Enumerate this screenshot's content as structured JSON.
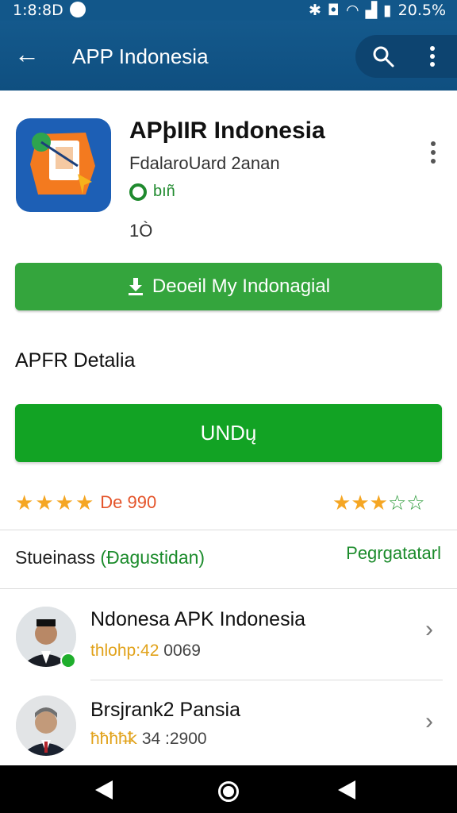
{
  "status_bar": {
    "time": "1:8:8D",
    "battery": "20.5%"
  },
  "app_bar": {
    "title": "APP Indonesia"
  },
  "app": {
    "title": "APþIIR Indonesia",
    "developer": "FdalaroUard 2anan",
    "badge": "bıñ",
    "reviews": "1Ò"
  },
  "primary_button": {
    "label": "Deoeil My Indonagial"
  },
  "section_title": "APFR Detalia",
  "secondary_button": {
    "label": "UNDų"
  },
  "rating_left": {
    "value": "De 990",
    "stars": 4
  },
  "rating_right": {
    "stars": 3,
    "outline_stars": 2
  },
  "subheader": {
    "prefix": "Stueinass",
    "highlight": "(Đagustidan)",
    "right": "Pegrgatatarl"
  },
  "list": [
    {
      "name": "Ndonesa APK Indonesia",
      "sub_highlight": "thlohp:42",
      "sub_rest": "0069",
      "online": true
    },
    {
      "name": "Brsjrank2 Pansia",
      "sub_highlight": "ħħħħ̶ꝁ",
      "sub_rest": "34 :2900",
      "online": false
    }
  ],
  "colors": {
    "appbar": "#12578a",
    "primary_green": "#34a53d",
    "secondary_green": "#12a324",
    "star": "#f5a623"
  }
}
